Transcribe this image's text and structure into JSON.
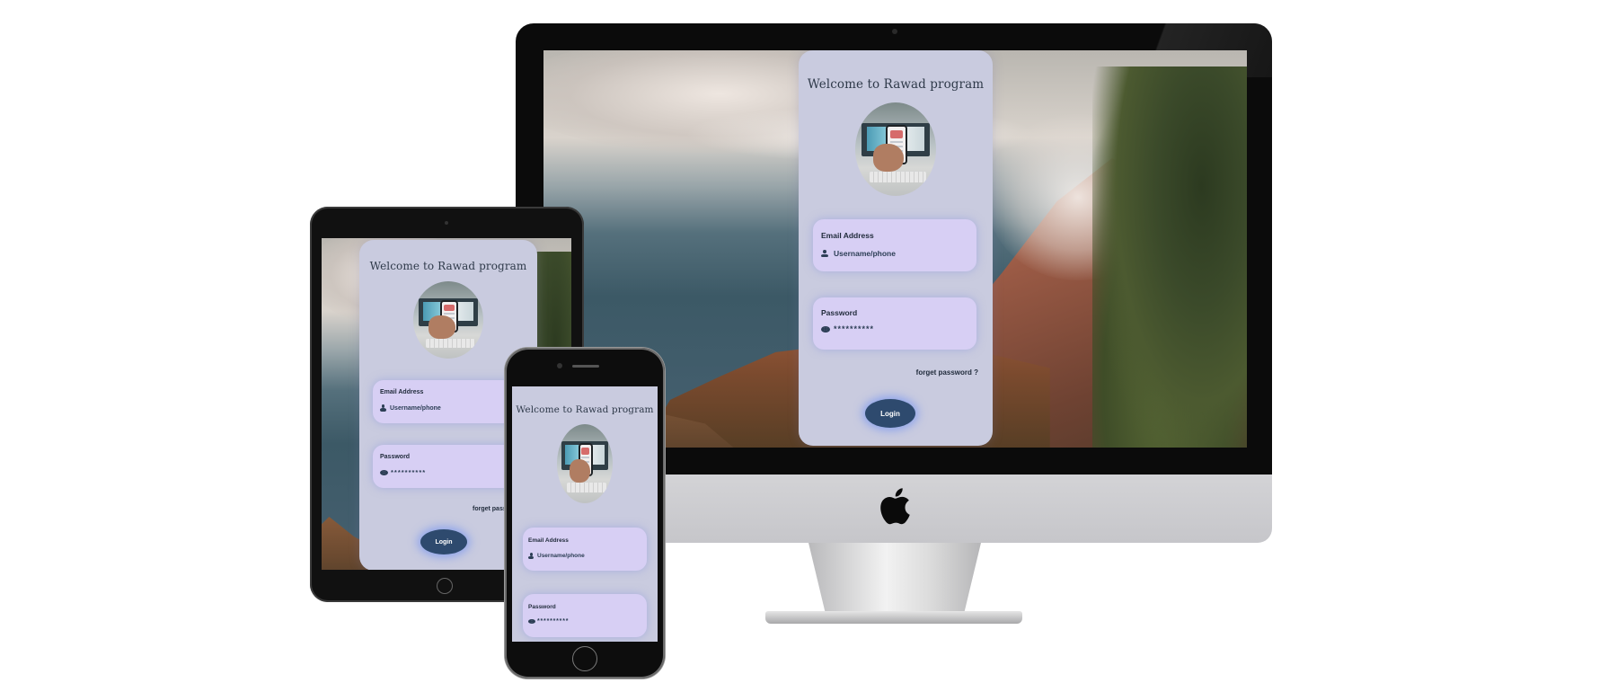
{
  "login": {
    "title": "Welcome to Rawad program",
    "email_label": "Email Address",
    "email_placeholder": "Username/phone",
    "password_label": "Password",
    "password_mask": "**********",
    "forgot_label": "forget password ?",
    "forgot_truncated": "forget pass",
    "login_button": "Login"
  },
  "colors": {
    "card_bg": "#c9cbdf",
    "field_bg": "#d7cff4",
    "button_bg": "#2e4a6e",
    "text_dark": "#1f2a3a"
  },
  "icons": {
    "email_field": "user-icon",
    "password_field": "eye-icon",
    "brand": "apple-logo-icon"
  }
}
